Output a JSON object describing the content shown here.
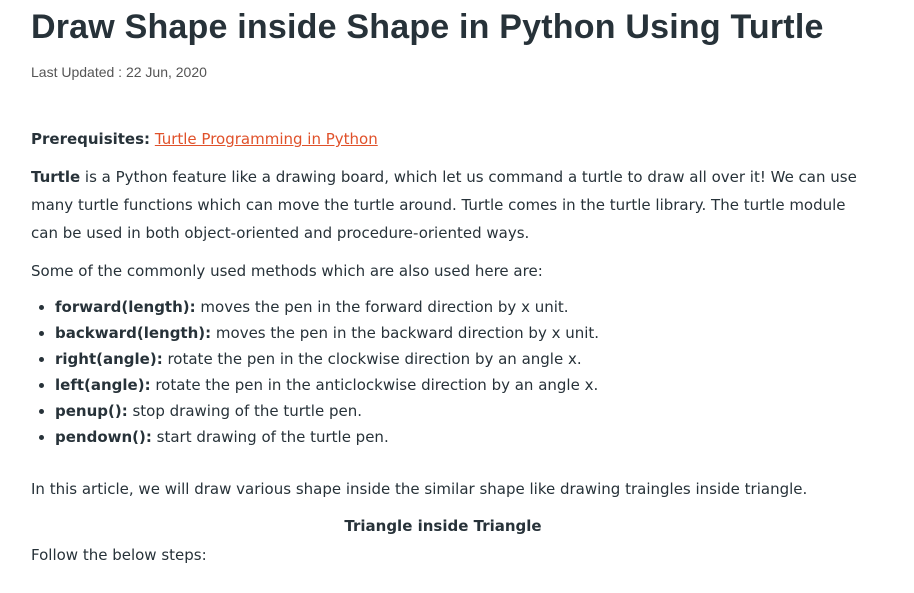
{
  "title": "Draw Shape inside Shape in Python Using Turtle",
  "last_updated": "Last Updated : 22 Jun, 2020",
  "prerequisites": {
    "label": "Prerequisites:",
    "link": "Turtle Programming in Python"
  },
  "intro": {
    "bold": "Turtle",
    "text": " is a Python feature like a drawing board, which let us command a turtle to draw all over it! We can use many turtle functions which can move the turtle around. Turtle comes in the turtle library. The turtle module can be used in both object-oriented and procedure-oriented ways."
  },
  "methods_intro": "Some of the commonly used methods which are also used here are:",
  "methods": [
    {
      "name": "forward(length):",
      "desc": " moves the pen in the forward direction by x unit."
    },
    {
      "name": "backward(length):",
      "desc": " moves the pen in the backward direction by x unit."
    },
    {
      "name": "right(angle):",
      "desc": " rotate the pen in the clockwise direction by an angle x."
    },
    {
      "name": "left(angle):",
      "desc": " rotate the pen in the anticlockwise direction by an angle x."
    },
    {
      "name": "penup():",
      "desc": " stop drawing of the turtle pen."
    },
    {
      "name": "pendown():",
      "desc": " start drawing of the turtle pen."
    }
  ],
  "article_text": "In this article, we will draw various shape inside the similar shape like drawing traingles inside triangle.",
  "section_heading": "Triangle inside Triangle",
  "follow": "Follow the below steps:",
  "colors": {
    "text": "#273239",
    "link": "#e0512a"
  }
}
